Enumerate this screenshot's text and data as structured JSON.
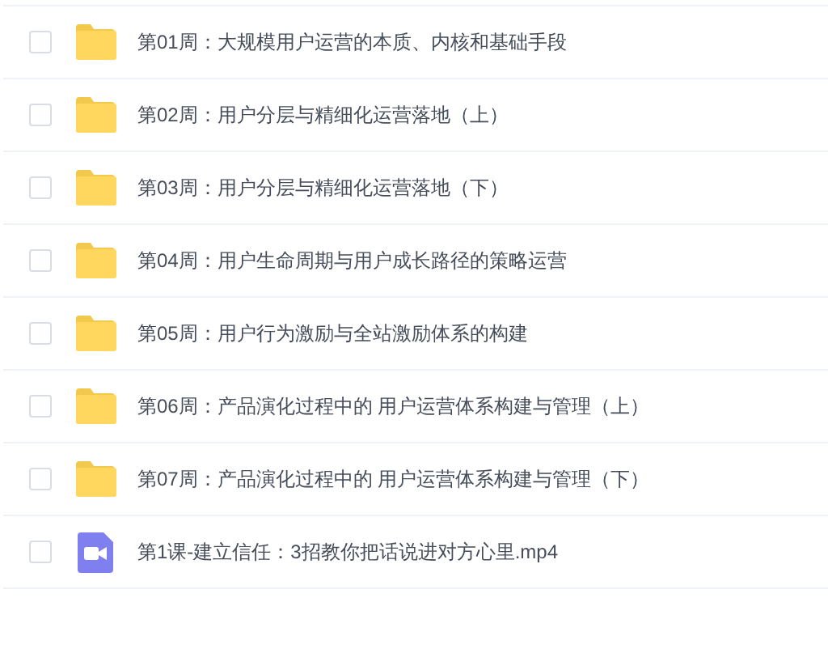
{
  "files": [
    {
      "kind": "folder",
      "name": "第01周：大规模用户运营的本质、内核和基础手段",
      "checked": false
    },
    {
      "kind": "folder",
      "name": "第02周：用户分层与精细化运营落地（上）",
      "checked": false
    },
    {
      "kind": "folder",
      "name": "第03周：用户分层与精细化运营落地（下）",
      "checked": false
    },
    {
      "kind": "folder",
      "name": "第04周：用户生命周期与用户成长路径的策略运营",
      "checked": false
    },
    {
      "kind": "folder",
      "name": "第05周：用户行为激励与全站激励体系的构建",
      "checked": false
    },
    {
      "kind": "folder",
      "name": "第06周：产品演化过程中的 用户运营体系构建与管理（上）",
      "checked": false
    },
    {
      "kind": "folder",
      "name": "第07周：产品演化过程中的 用户运营体系构建与管理（下）",
      "checked": false
    },
    {
      "kind": "video",
      "name": "第1课-建立信任：3招教你把话说进对方心里.mp4",
      "checked": false
    }
  ]
}
